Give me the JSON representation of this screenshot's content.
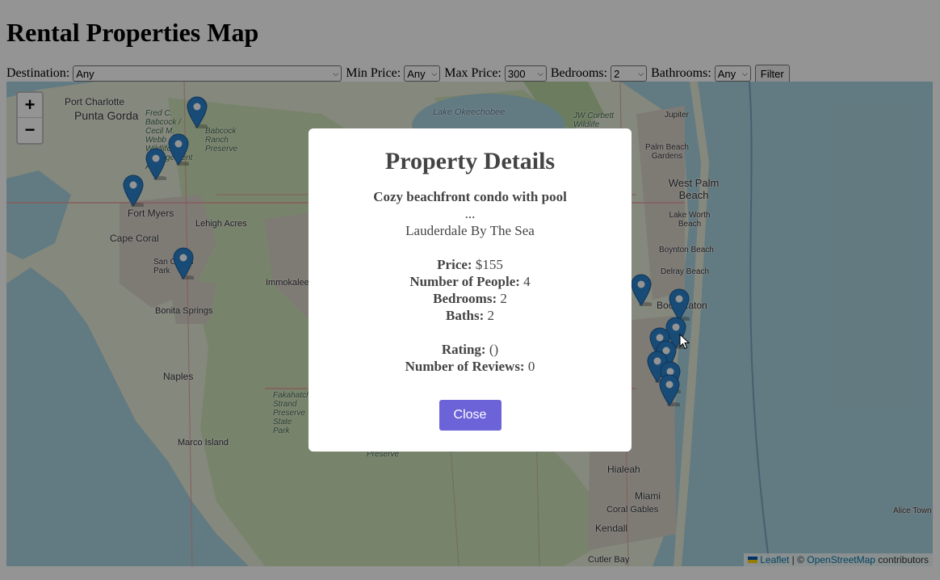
{
  "page": {
    "title": "Rental Properties Map"
  },
  "filters": {
    "destination_label": "Destination:",
    "destination_value": "Any",
    "min_price_label": "Min Price:",
    "min_price_value": "Any",
    "max_price_label": "Max Price:",
    "max_price_value": "300",
    "bedrooms_label": "Bedrooms:",
    "bedrooms_value": "2",
    "bathrooms_label": "Bathrooms:",
    "bathrooms_value": "Any",
    "filter_button": "Filter"
  },
  "map": {
    "zoom_in": "+",
    "zoom_out": "−",
    "labels": {
      "port_charlotte": "Port Charlotte",
      "punta_gorda": "Punta Gorda",
      "lake_okeechobee": "Lake Okeechobee",
      "jupiter": "Jupiter",
      "palm_beach_gardens": "Palm Beach Gardens",
      "west_palm_beach": "West Palm Beach",
      "lake_worth_beach": "Lake Worth Beach",
      "boynton_beach": "Boynton Beach",
      "delray_beach": "Delray Beach",
      "boca_raton": "Boca Raton",
      "fort_myers": "Fort Myers",
      "cape_coral": "Cape Coral",
      "lehigh_acres": "Lehigh Acres",
      "san_carlos_park": "San Carlos Park",
      "immokalee": "Immokalee",
      "bonita_springs": "Bonita Springs",
      "naples": "Naples",
      "marco_island": "Marco Island",
      "hialeah": "Hialeah",
      "miami": "Miami",
      "coral_gables": "Coral Gables",
      "kendall": "Kendall",
      "cutler_bay": "Cutler Bay",
      "alice_town": "Alice Town",
      "fred_c_babcock": "Fred C. Babcock / Cecil M. Webb Wildlife Management Area",
      "babcock_ranch": "Babcock Ranch Preserve",
      "jw_corbett": "JW Corbett Wildlife",
      "fakahatchee": "Fakahatchee Strand Preserve State Park",
      "preserve": "Preserve"
    },
    "attribution": {
      "leaflet": "Leaflet",
      "separator": " | © ",
      "osm": "OpenStreetMap",
      "contributors": " contributors"
    },
    "marker_icon": "map-pin-icon",
    "marker_color": "#2a81cb"
  },
  "modal": {
    "title": "Property Details",
    "property_name": "Cozy beachfront condo with pool",
    "ellipsis": "...",
    "location": "Lauderdale By The Sea",
    "price_label": "Price:",
    "price_value": "$155",
    "people_label": "Number of People:",
    "people_value": "4",
    "bedrooms_label": "Bedrooms:",
    "bedrooms_value": "2",
    "baths_label": "Baths:",
    "baths_value": "2",
    "rating_label": "Rating:",
    "rating_value": "()",
    "reviews_label": "Number of Reviews:",
    "reviews_value": "0",
    "close_button": "Close",
    "close_button_color": "#6c63d8"
  }
}
